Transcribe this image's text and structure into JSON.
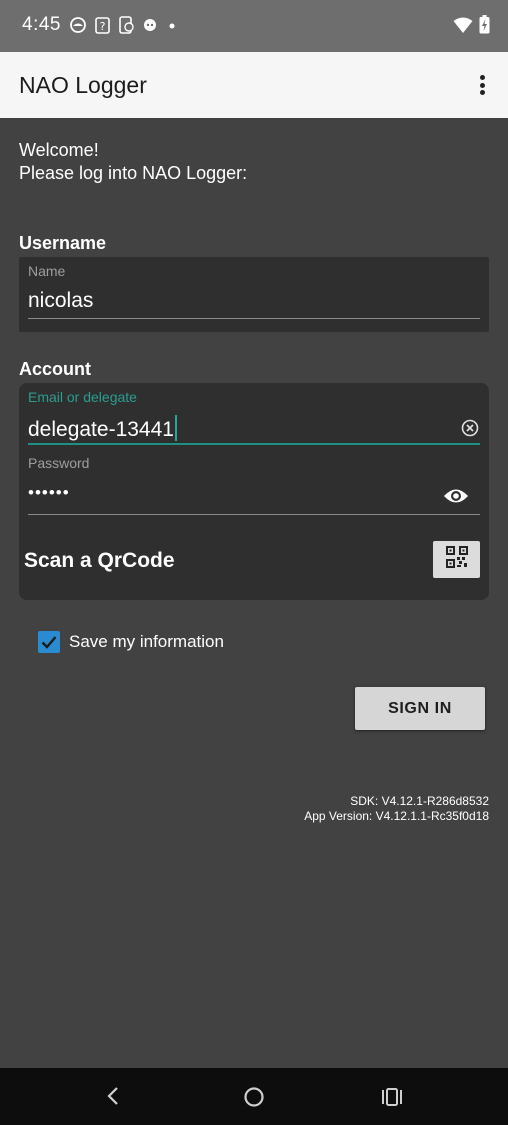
{
  "status_bar": {
    "time": "4:45",
    "left_icons": [
      "notification-icon",
      "sim-question-icon",
      "phone-sync-icon",
      "game-icon",
      "dot-icon"
    ],
    "right_icons": [
      "wifi-icon",
      "battery-charging-icon"
    ]
  },
  "app_bar": {
    "title": "NAO Logger"
  },
  "welcome": {
    "line1": "Welcome!",
    "line2": "Please log into NAO Logger:"
  },
  "username_section": {
    "heading": "Username",
    "field_label": "Name",
    "value": "nicolas"
  },
  "account_section": {
    "heading": "Account",
    "email_label": "Email or delegate",
    "email_value": "delegate-13441",
    "password_label": "Password",
    "password_value": "••••••",
    "scan_label": "Scan a QrCode"
  },
  "save_info": {
    "label": "Save my information",
    "checked": true
  },
  "sign_in": {
    "label": "SIGN IN"
  },
  "version": {
    "sdk": "SDK: V4.12.1-R286d8532",
    "app": "App Version: V4.12.1.1-Rc35f0d18"
  },
  "colors": {
    "background": "#424242",
    "card": "#2f2f2f",
    "accent_teal": "#26a69a",
    "checkbox_blue": "#2a8bd0",
    "app_bar": "#f6f6f6"
  }
}
